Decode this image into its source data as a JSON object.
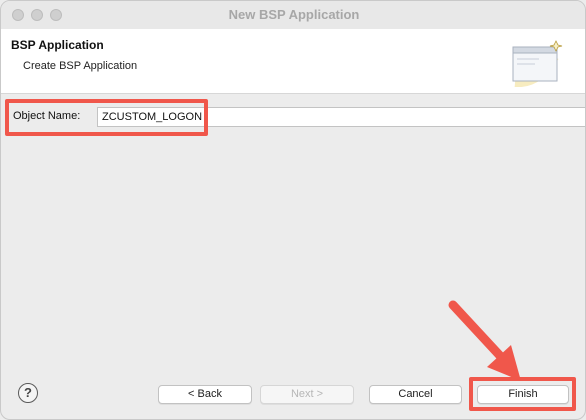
{
  "window": {
    "title": "New BSP Application"
  },
  "header": {
    "title": "BSP Application",
    "description": "Create BSP Application",
    "icon": "wizard-banner-icon"
  },
  "form": {
    "object_name_label": "Object Name:",
    "object_name_value": "ZCUSTOM_LOGON"
  },
  "footer": {
    "help_symbol": "?",
    "back_label": "< Back",
    "next_label": "Next >",
    "cancel_label": "Cancel",
    "finish_label": "Finish"
  },
  "annotations": {
    "highlight_color": "#f0574b"
  }
}
